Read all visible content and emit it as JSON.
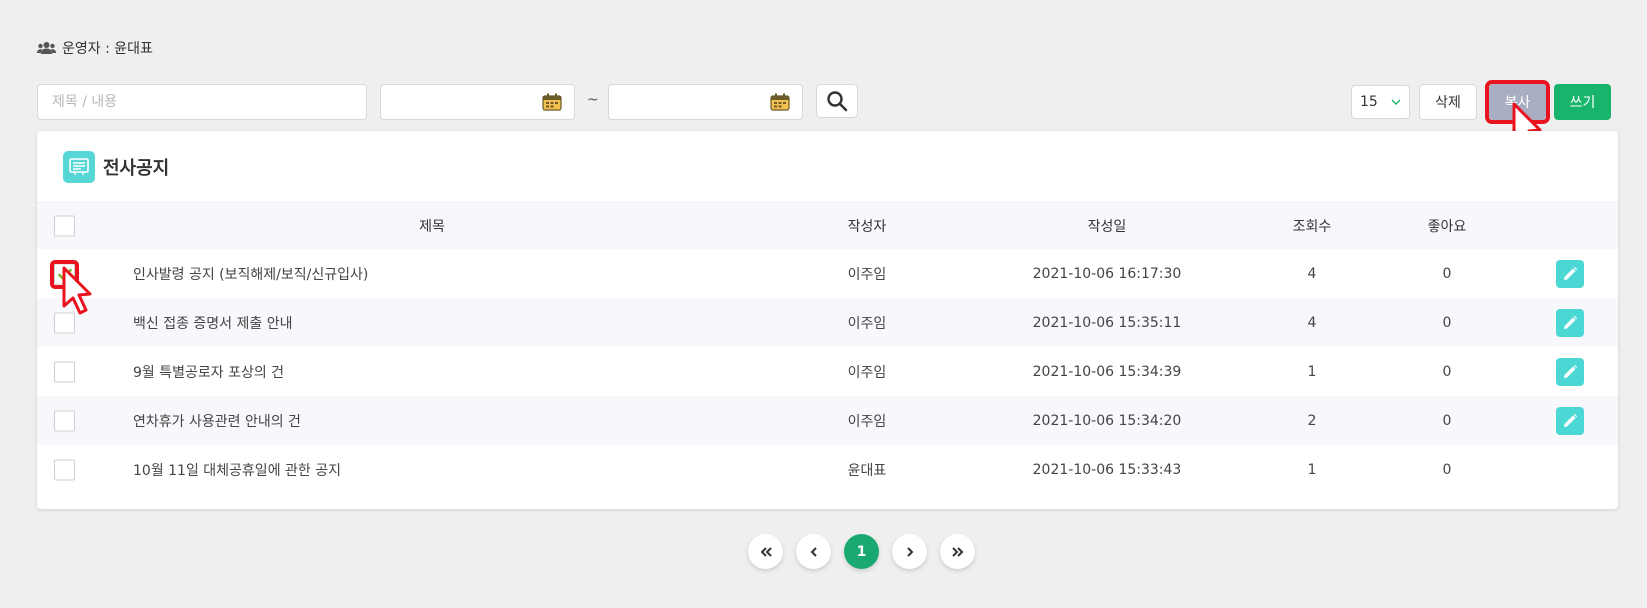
{
  "operator": {
    "text": "운영자 : 윤대표",
    "icon": "users-icon"
  },
  "toolbar": {
    "search_placeholder": "제목 / 내용",
    "date_from_value": "",
    "date_to_value": "",
    "tilde": "~",
    "per_page": "15",
    "delete_label": "삭제",
    "copy_label": "복사",
    "write_label": "쓰기"
  },
  "board": {
    "title": "전사공지",
    "icon": "board-icon"
  },
  "table": {
    "headers": {
      "title": "제목",
      "author": "작성자",
      "date": "작성일",
      "views": "조회수",
      "likes": "좋아요"
    },
    "rows": [
      {
        "title": "인사발령 공지 (보직해제/보직/신규입사)",
        "author": "이주임",
        "date": "2021-10-06 16:17:30",
        "views": "4",
        "likes": "0",
        "checked": true,
        "editable": true
      },
      {
        "title": "백신 접종 증명서 제출 안내",
        "author": "이주임",
        "date": "2021-10-06 15:35:11",
        "views": "4",
        "likes": "0",
        "checked": false,
        "editable": true
      },
      {
        "title": "9월 특별공로자 포상의 건",
        "author": "이주임",
        "date": "2021-10-06 15:34:39",
        "views": "1",
        "likes": "0",
        "checked": false,
        "editable": true
      },
      {
        "title": "연차휴가 사용관련 안내의 건",
        "author": "이주임",
        "date": "2021-10-06 15:34:20",
        "views": "2",
        "likes": "0",
        "checked": false,
        "editable": true
      },
      {
        "title": "10월 11일 대체공휴일에 관한 공지",
        "author": "윤대표",
        "date": "2021-10-06 15:33:43",
        "views": "1",
        "likes": "0",
        "checked": false,
        "editable": false
      }
    ]
  },
  "pagination": {
    "current": "1"
  },
  "colors": {
    "accent_green": "#19b46c",
    "teal": "#4bd8d4",
    "copy_gray": "#a9aec3",
    "highlight_red": "#e8131e"
  }
}
